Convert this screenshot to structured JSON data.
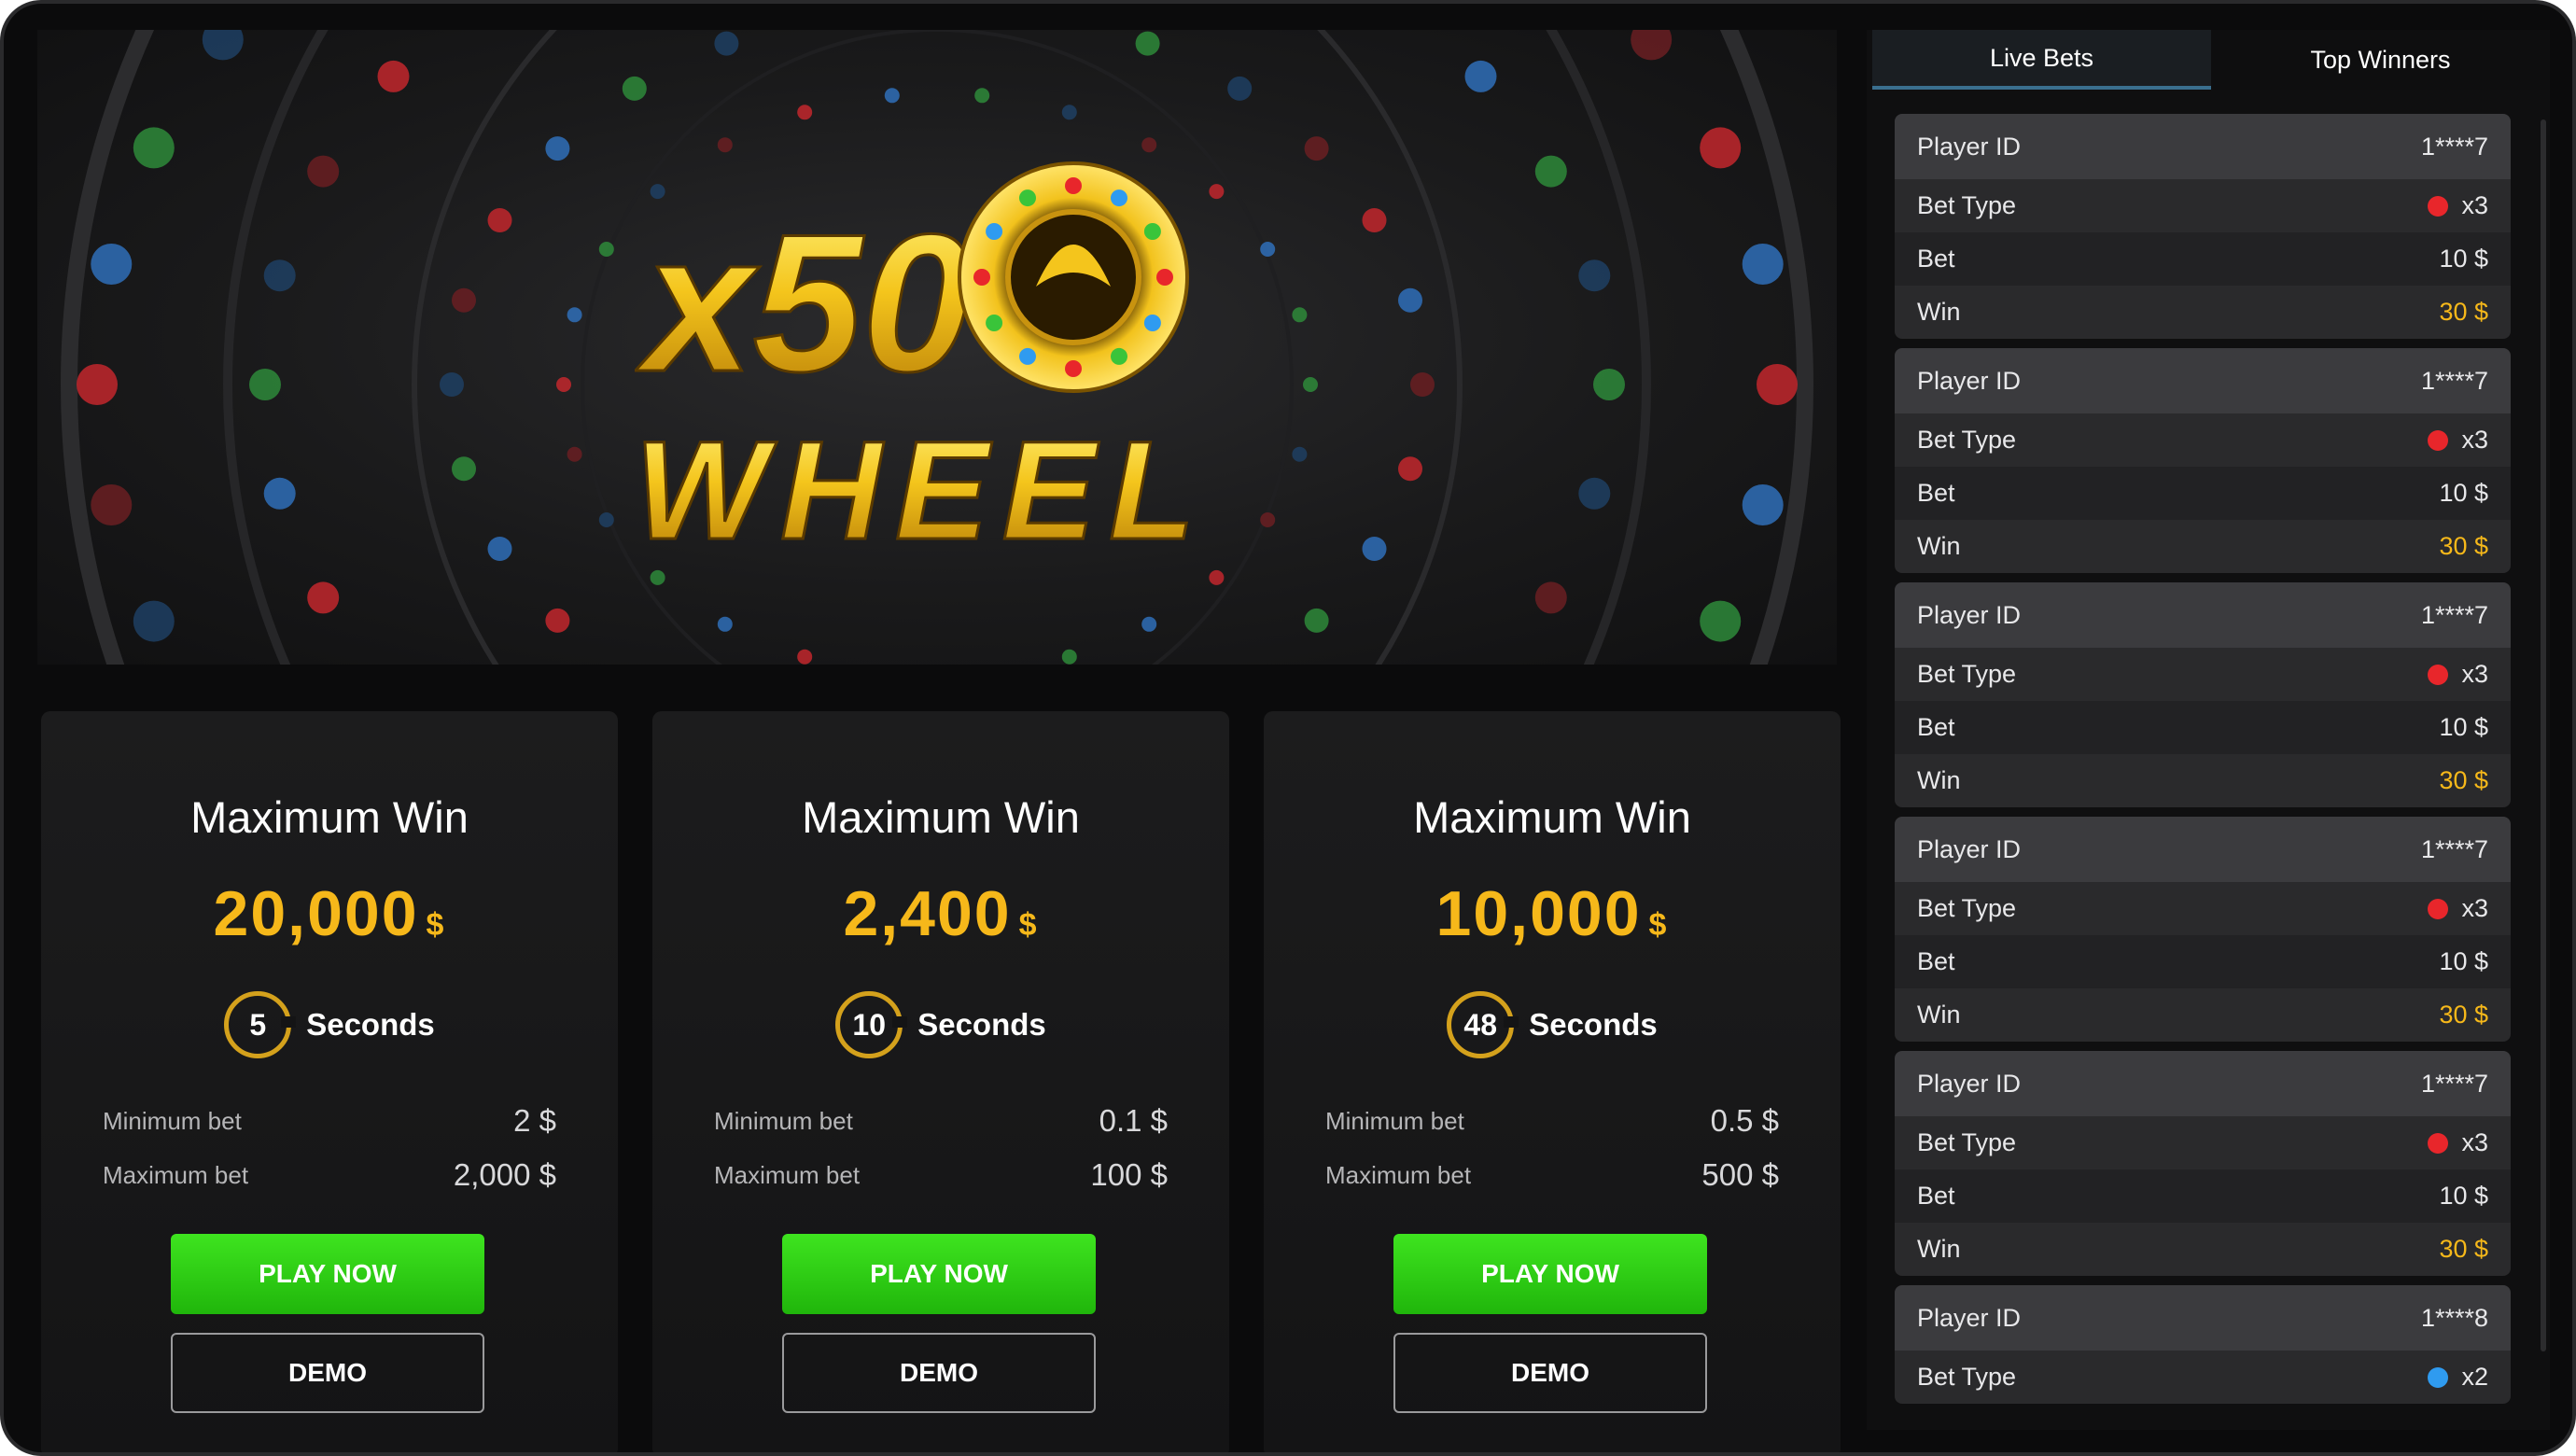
{
  "banner": {
    "logo_top": "x50",
    "logo_bottom": "WHEEL"
  },
  "games": [
    {
      "title": "Maximum Win",
      "amount": "20,000",
      "currency": "$",
      "timer": "5",
      "timer_label": "Seconds",
      "min_label": "Minimum bet",
      "min_value": "2 $",
      "max_label": "Maximum bet",
      "max_value": "2,000 $",
      "play_label": "PLAY NOW",
      "demo_label": "DEMO"
    },
    {
      "title": "Maximum Win",
      "amount": "2,400",
      "currency": "$",
      "timer": "10",
      "timer_label": "Seconds",
      "min_label": "Minimum bet",
      "min_value": "0.1 $",
      "max_label": "Maximum bet",
      "max_value": "100 $",
      "play_label": "PLAY NOW",
      "demo_label": "DEMO"
    },
    {
      "title": "Maximum Win",
      "amount": "10,000",
      "currency": "$",
      "timer": "48",
      "timer_label": "Seconds",
      "min_label": "Minimum bet",
      "min_value": "0.5 $",
      "max_label": "Maximum bet",
      "max_value": "500 $",
      "play_label": "PLAY NOW",
      "demo_label": "DEMO"
    }
  ],
  "tabs": {
    "live_bets": "Live Bets",
    "top_winners": "Top Winners"
  },
  "bets": [
    {
      "player_label": "Player ID",
      "player_id": "1****7",
      "type_label": "Bet Type",
      "type_value": "x3",
      "type_color": "#e8262b",
      "bet_label": "Bet",
      "bet_value": "10 $",
      "win_label": "Win",
      "win_value": "30 $"
    },
    {
      "player_label": "Player ID",
      "player_id": "1****7",
      "type_label": "Bet Type",
      "type_value": "x3",
      "type_color": "#e8262b",
      "bet_label": "Bet",
      "bet_value": "10 $",
      "win_label": "Win",
      "win_value": "30 $"
    },
    {
      "player_label": "Player ID",
      "player_id": "1****7",
      "type_label": "Bet Type",
      "type_value": "x3",
      "type_color": "#e8262b",
      "bet_label": "Bet",
      "bet_value": "10 $",
      "win_label": "Win",
      "win_value": "30 $"
    },
    {
      "player_label": "Player ID",
      "player_id": "1****7",
      "type_label": "Bet Type",
      "type_value": "x3",
      "type_color": "#e8262b",
      "bet_label": "Bet",
      "bet_value": "10 $",
      "win_label": "Win",
      "win_value": "30 $"
    },
    {
      "player_label": "Player ID",
      "player_id": "1****7",
      "type_label": "Bet Type",
      "type_value": "x3",
      "type_color": "#e8262b",
      "bet_label": "Bet",
      "bet_value": "10 $",
      "win_label": "Win",
      "win_value": "30 $"
    },
    {
      "player_label": "Player ID",
      "player_id": "1****8",
      "type_label": "Bet Type",
      "type_value": "x2",
      "type_color": "#2f9bf0"
    }
  ],
  "colors": {
    "accent_gold": "#f6b81a",
    "play_green": "#2fcf14",
    "background": "#0b0b0c"
  }
}
